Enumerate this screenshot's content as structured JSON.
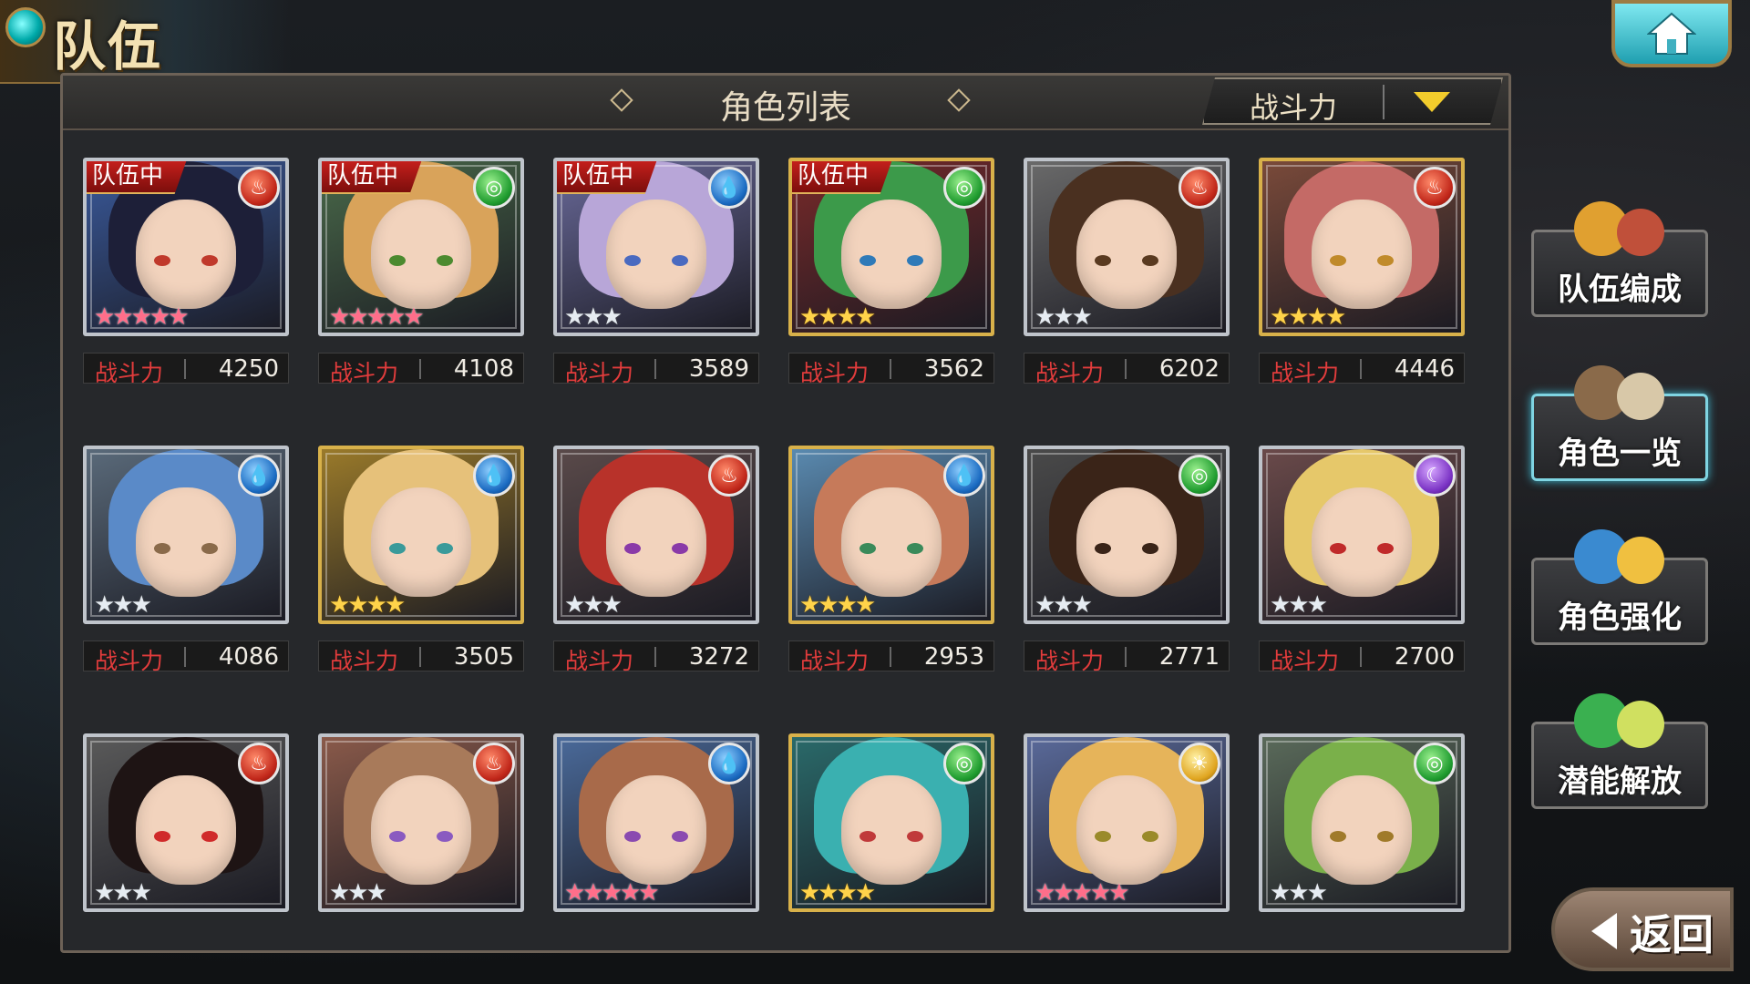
{
  "header": {
    "title": "队伍"
  },
  "panel": {
    "title": "角色列表",
    "sort_label": "战斗力"
  },
  "power_label": "战斗力",
  "characters": [
    {
      "in_team": true,
      "element": "fire",
      "stars": 5,
      "power": "4250",
      "hair": "#1d1f38",
      "eye": "#c0392b",
      "bg": "#3a5a9c",
      "gold": false
    },
    {
      "in_team": true,
      "element": "wind",
      "stars": 5,
      "power": "4108",
      "hair": "#d9a35a",
      "eye": "#4c8a2f",
      "bg": "#4a6a4a",
      "gold": false
    },
    {
      "in_team": true,
      "element": "water",
      "stars": 3,
      "power": "3589",
      "hair": "#b8a6d8",
      "eye": "#4a6ac0",
      "bg": "#6a6a9a",
      "gold": false
    },
    {
      "in_team": true,
      "element": "wind",
      "stars": 4,
      "power": "3562",
      "hair": "#3c9a4a",
      "eye": "#2f7ab8",
      "bg": "#7a2a2a",
      "gold": true
    },
    {
      "in_team": false,
      "element": "fire",
      "stars": 3,
      "power": "6202",
      "hair": "#4a3020",
      "eye": "#5a3a20",
      "bg": "#6a6a6a",
      "gold": false
    },
    {
      "in_team": false,
      "element": "fire",
      "stars": 4,
      "power": "4446",
      "hair": "#c46a66",
      "eye": "#c08a2a",
      "bg": "#7a4a3a",
      "gold": true
    },
    {
      "in_team": false,
      "element": "water",
      "stars": 3,
      "power": "4086",
      "hair": "#5a8ac8",
      "eye": "#8a6a4a",
      "bg": "#5a6a7a",
      "gold": false
    },
    {
      "in_team": false,
      "element": "water",
      "stars": 4,
      "power": "3505",
      "hair": "#e6c17a",
      "eye": "#3a9a9a",
      "bg": "#9a7a2a",
      "gold": true
    },
    {
      "in_team": false,
      "element": "fire",
      "stars": 3,
      "power": "3272",
      "hair": "#b8322a",
      "eye": "#8a3aa8",
      "bg": "#5a4a4a",
      "gold": false
    },
    {
      "in_team": false,
      "element": "water",
      "stars": 4,
      "power": "2953",
      "hair": "#c67a5a",
      "eye": "#3a8a5a",
      "bg": "#5a8ab0",
      "gold": true
    },
    {
      "in_team": false,
      "element": "wind",
      "stars": 3,
      "power": "2771",
      "hair": "#3a2418",
      "eye": "#3a2418",
      "bg": "#4a4a4a",
      "gold": false
    },
    {
      "in_team": false,
      "element": "dark",
      "stars": 3,
      "power": "2700",
      "hair": "#e6c86a",
      "eye": "#c02a2a",
      "bg": "#6a4a4a",
      "gold": false
    },
    {
      "in_team": false,
      "element": "fire",
      "stars": 3,
      "power": "",
      "hair": "#1e1414",
      "eye": "#d02a2a",
      "bg": "#5a5a5a",
      "gold": false
    },
    {
      "in_team": false,
      "element": "fire",
      "stars": 3,
      "power": "",
      "hair": "#a87a5a",
      "eye": "#8a5ac0",
      "bg": "#8a5a4a",
      "gold": false
    },
    {
      "in_team": false,
      "element": "water",
      "stars": 5,
      "power": "",
      "hair": "#a86a4a",
      "eye": "#8a4ab0",
      "bg": "#4a6a9a",
      "gold": false
    },
    {
      "in_team": false,
      "element": "wind",
      "stars": 4,
      "power": "",
      "hair": "#3ab0b0",
      "eye": "#c03a3a",
      "bg": "#2a6a6a",
      "gold": true
    },
    {
      "in_team": false,
      "element": "light",
      "stars": 5,
      "power": "",
      "hair": "#e6b45a",
      "eye": "#9a8a2a",
      "bg": "#5a6a9a",
      "gold": false
    },
    {
      "in_team": false,
      "element": "wind",
      "stars": 3,
      "power": "",
      "hair": "#7ab04a",
      "eye": "#a07a2a",
      "bg": "#5a6a5a",
      "gold": false
    }
  ],
  "badge_text": "队伍中",
  "side_menu": [
    {
      "label": "队伍编成",
      "active": false
    },
    {
      "label": "角色一览",
      "active": true
    },
    {
      "label": "角色强化",
      "active": false
    },
    {
      "label": "潜能解放",
      "active": false
    }
  ],
  "back_label": "返回",
  "element_glyphs": {
    "fire": "♨",
    "water": "💧",
    "wind": "◎",
    "dark": "☾",
    "light": "☀"
  }
}
